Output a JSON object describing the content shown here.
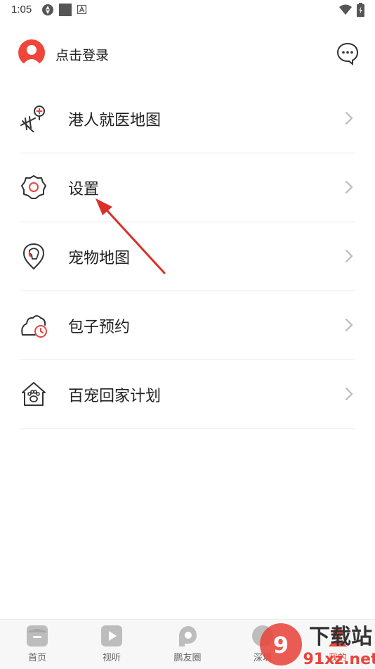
{
  "status_bar": {
    "time": "1:05"
  },
  "header": {
    "login_label": "点击登录",
    "avatar_icon": "user-avatar-icon",
    "message_icon": "chat-bubble-icon"
  },
  "menu": {
    "items": [
      {
        "label": "港人就医地图",
        "icon": "medical-map-icon"
      },
      {
        "label": "设置",
        "icon": "settings-gear-icon"
      },
      {
        "label": "宠物地图",
        "icon": "pet-map-icon"
      },
      {
        "label": "包子预约",
        "icon": "bun-booking-icon"
      },
      {
        "label": "百宠回家计划",
        "icon": "pet-home-icon"
      }
    ],
    "arrow_icon": "chevron-right-icon"
  },
  "bottom_nav": {
    "items": [
      {
        "label": "首页",
        "icon": "home-icon"
      },
      {
        "label": "视听",
        "icon": "play-icon"
      },
      {
        "label": "鹏友圈",
        "icon": "friends-circle-icon"
      },
      {
        "label": "深圳",
        "icon": "city-icon"
      },
      {
        "label": "我的",
        "icon": "profile-icon"
      }
    ]
  },
  "watermark": {
    "brand": "下载站",
    "domain": "91xz.net"
  },
  "colors": {
    "accent": "#e8453c",
    "divider": "#ebebeb",
    "nav_bg": "#f7f7f7"
  }
}
